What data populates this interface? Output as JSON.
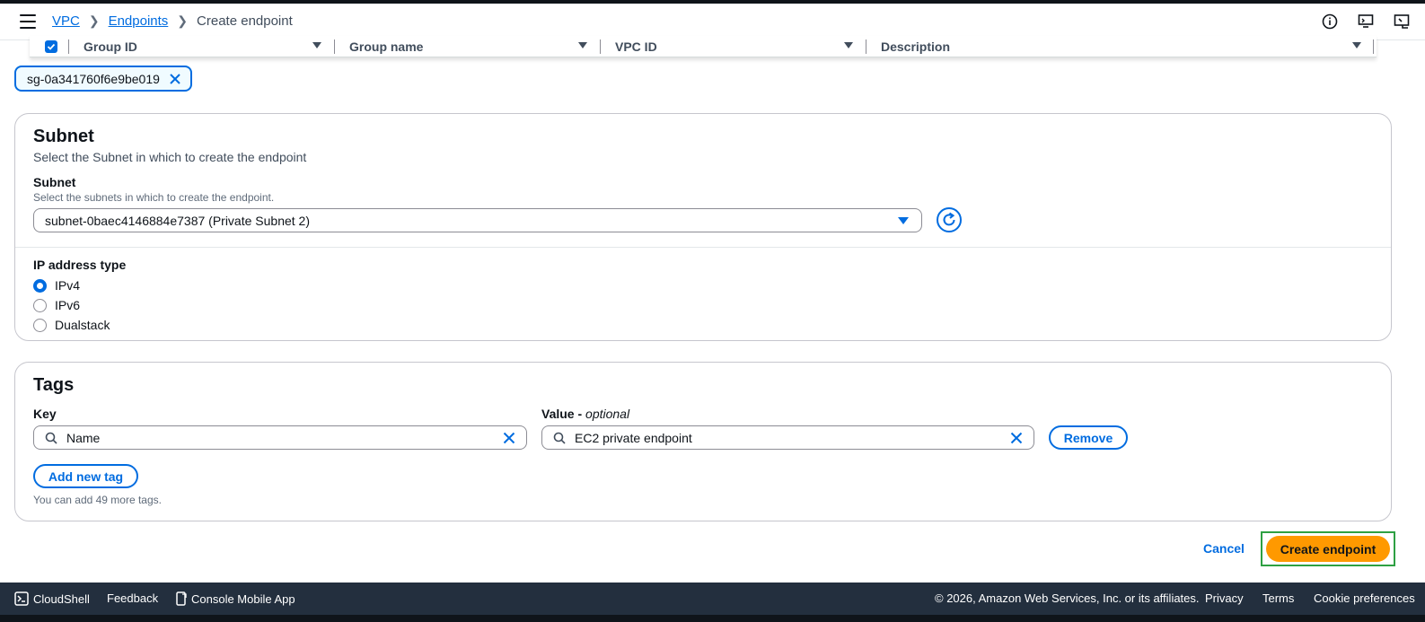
{
  "breadcrumb": {
    "items": [
      "VPC",
      "Endpoints"
    ],
    "current": "Create endpoint"
  },
  "sg_table": {
    "columns": [
      "Group ID",
      "Group name",
      "VPC ID",
      "Description"
    ]
  },
  "selected_token": "sg-0a341760f6e9be019",
  "subnet_section": {
    "title": "Subnet",
    "description": "Select the Subnet in which to create the endpoint",
    "field_label": "Subnet",
    "field_description": "Select the subnets in which to create the endpoint.",
    "selected_value": "subnet-0baec4146884e7387 (Private Subnet 2)",
    "ip_label": "IP address type",
    "ip_options": [
      {
        "label": "IPv4",
        "checked": true
      },
      {
        "label": "IPv6",
        "checked": false
      },
      {
        "label": "Dualstack",
        "checked": false
      }
    ]
  },
  "tags_section": {
    "title": "Tags",
    "key_label": "Key",
    "value_label": "Value - ",
    "value_label_optional": "optional",
    "key_value": "Name",
    "value_value": "EC2 private endpoint",
    "remove_label": "Remove",
    "add_label": "Add new tag",
    "hint": "You can add 49 more tags."
  },
  "actions": {
    "cancel": "Cancel",
    "create": "Create endpoint"
  },
  "footer": {
    "cloudshell": "CloudShell",
    "feedback": "Feedback",
    "mobile_app": "Console Mobile App",
    "copyright": "© 2026, Amazon Web Services, Inc. or its affiliates.",
    "privacy": "Privacy",
    "terms": "Terms",
    "cookies": "Cookie preferences"
  },
  "colors": {
    "accent": "#006ce0",
    "primary_button": "#ff9900",
    "footer_bg": "#232f3e",
    "highlight_border": "#2ea043"
  }
}
